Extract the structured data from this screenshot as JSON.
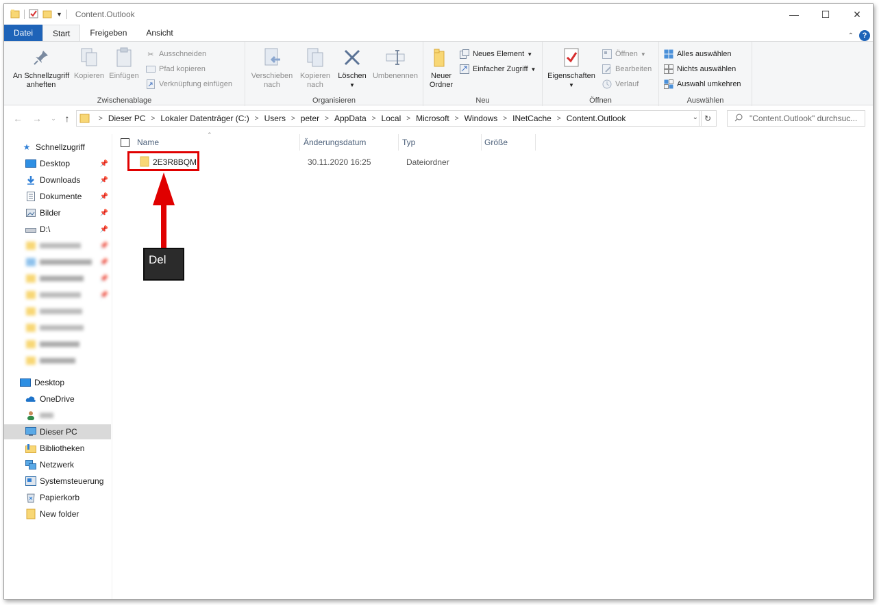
{
  "window": {
    "title": "Content.Outlook"
  },
  "tabs": {
    "file": "Datei",
    "start": "Start",
    "share": "Freigeben",
    "view": "Ansicht"
  },
  "ribbon": {
    "clipboard": {
      "label": "Zwischenablage",
      "pin_quick_access": "An Schnellzugriff\nanheften",
      "copy": "Kopieren",
      "paste": "Einfügen",
      "cut": "Ausschneiden",
      "copy_path": "Pfad kopieren",
      "paste_shortcut": "Verknüpfung einfügen"
    },
    "organize": {
      "label": "Organisieren",
      "move_to": "Verschieben\nnach",
      "copy_to": "Kopieren\nnach",
      "delete": "Löschen",
      "rename": "Umbenennen"
    },
    "new": {
      "label": "Neu",
      "new_folder": "Neuer\nOrdner",
      "new_item": "Neues Element",
      "easy_access": "Einfacher Zugriff"
    },
    "open": {
      "label": "Öffnen",
      "properties": "Eigenschaften",
      "open": "Öffnen",
      "edit": "Bearbeiten",
      "history": "Verlauf"
    },
    "select": {
      "label": "Auswählen",
      "select_all": "Alles auswählen",
      "select_none": "Nichts auswählen",
      "invert": "Auswahl umkehren"
    }
  },
  "address": {
    "crumbs": [
      "Dieser PC",
      "Lokaler Datenträger (C:)",
      "Users",
      "peter",
      "AppData",
      "Local",
      "Microsoft",
      "Windows",
      "INetCache",
      "Content.Outlook"
    ],
    "search_placeholder": "\"Content.Outlook\" durchsuc..."
  },
  "sidebar": {
    "quick_access": "Schnellzugriff",
    "pinned": [
      "Desktop",
      "Downloads",
      "Dokumente",
      "Bilder",
      "D:\\"
    ],
    "desktop": "Desktop",
    "onedrive": "OneDrive",
    "this_pc": "Dieser PC",
    "libraries": "Bibliotheken",
    "network": "Netzwerk",
    "control_panel": "Systemsteuerung",
    "recycle_bin": "Papierkorb",
    "new_folder": "New folder"
  },
  "columns": {
    "name": "Name",
    "modified": "Änderungsdatum",
    "type": "Typ",
    "size": "Größe"
  },
  "files": [
    {
      "name": "2E3R8BQM",
      "modified": "30.11.2020 16:25",
      "type": "Dateiordner",
      "size": ""
    }
  ],
  "annotation": {
    "key_label": "Del"
  },
  "colors": {
    "accent": "#1e63b8",
    "folder": "#f8d775",
    "annotation_red": "#e00000"
  }
}
